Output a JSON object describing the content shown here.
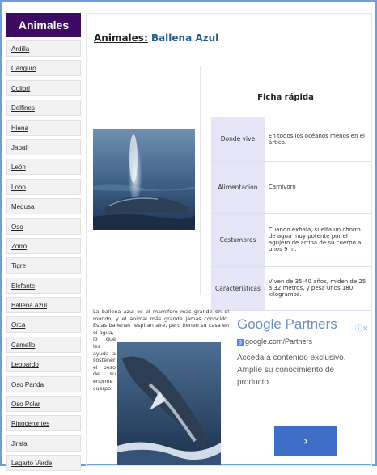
{
  "sidebar": {
    "title": "Animales",
    "items": [
      "Ardilla",
      "Canguro",
      "Colibrí",
      "Delfines",
      "Hiena",
      "Jabalí",
      "León",
      "Lobo",
      "Medusa",
      "Oso",
      "Zorro",
      "Tigre",
      "Elefante",
      "Ballena Azul",
      "Orca",
      "Camello",
      "Leopardo",
      "Oso Panda",
      "Oso Polar",
      "Rinocerontes",
      "Jirafa",
      "Lagarto Verde"
    ]
  },
  "header": {
    "section_label": "Animales:",
    "name": "Ballena Azul"
  },
  "ficha": {
    "title": "Ficha rápida",
    "rows": [
      {
        "label": "Donde vive",
        "value": "En todos los océanos menos en el ártico."
      },
      {
        "label": "Alimentación",
        "value": "Carnívoro"
      },
      {
        "label": "Costumbres",
        "value": "Cuando exhala, suelta un chorro de agua muy potente por el agujero de arriba de su cuerpo a unos 9 m."
      },
      {
        "label": "Características",
        "value": "Viven de 35-40 años, miden de 25 a 32 metros, y pesa unos 180 kilogramos."
      }
    ]
  },
  "description": {
    "full": "La ballena azul es el mamífero mas grande en el mundo, y el animal más grande jamás conocido. Estas ballenas respiran aire, pero tienen su casa en el agua,",
    "narrow": "lo que les ayuda a sostener el peso de su enorme cuerpo."
  },
  "ad": {
    "title": "Google Partners",
    "url": "google.com/Partners",
    "description": "Acceda a contenido exclusivo. Amplíe su conocimiento de producto.",
    "button_icon": "chevron-right-icon",
    "badge_icon": "adchoices-close-icon",
    "accent": "#3f6ec8"
  }
}
